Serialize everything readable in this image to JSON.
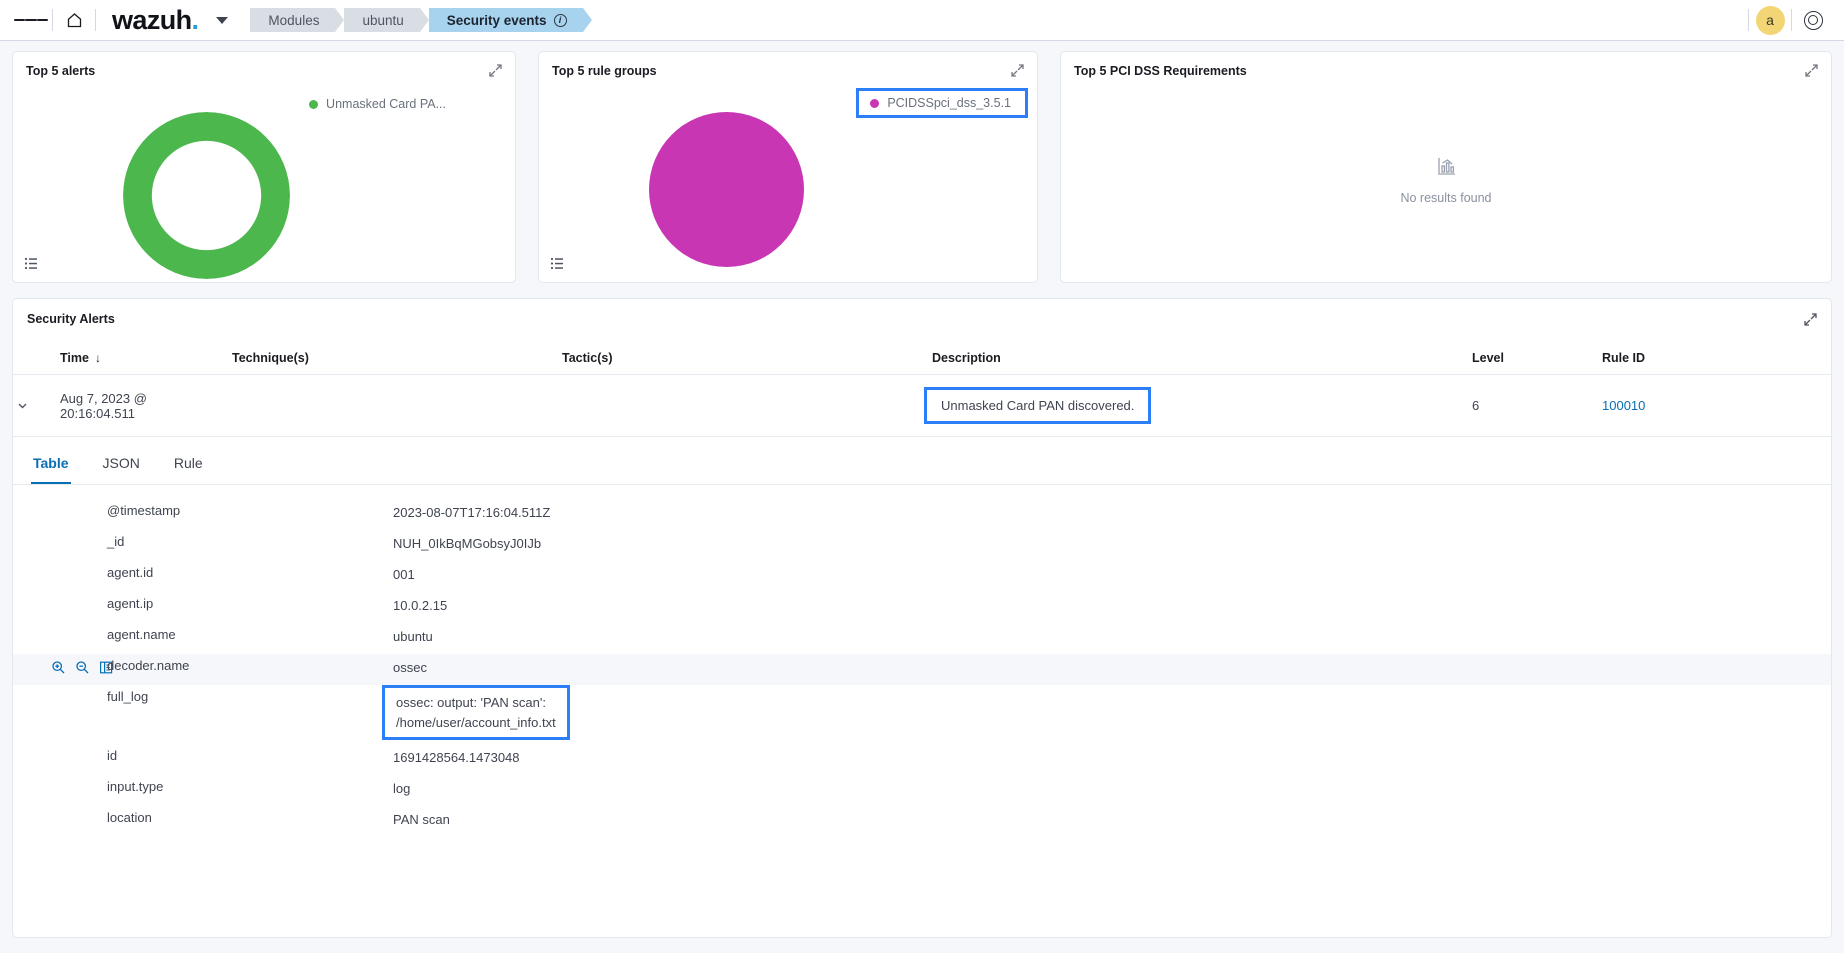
{
  "topnav": {
    "menu_icon": "hamburger-menu-icon",
    "home_icon": "home-icon",
    "logo": "wazuh",
    "logo_dot": ".",
    "breadcrumbs": [
      {
        "label": "Modules",
        "active": false
      },
      {
        "label": "ubuntu",
        "active": false
      },
      {
        "label": "Security events",
        "active": true,
        "info": "i"
      }
    ],
    "avatar_initial": "a",
    "help_icon": "lifebuoy-icon"
  },
  "panels": [
    {
      "title": "Top 5 alerts",
      "legend_label": "Unmasked Card PA...",
      "legend_color": "#4cb74c",
      "highlighted": false,
      "viz": "donut",
      "expand_icon": "expand-icon",
      "list_icon": "legend-list-icon"
    },
    {
      "title": "Top 5 rule groups",
      "legend_label": "PCIDSSpci_dss_3.5.1",
      "legend_color": "#c836b4",
      "highlighted": true,
      "viz": "pie",
      "expand_icon": "expand-icon",
      "list_icon": "legend-list-icon"
    },
    {
      "title": "Top 5 PCI DSS Requirements",
      "empty_label": "No results found",
      "empty_icon": "chart-placeholder-icon",
      "viz": "empty",
      "expand_icon": "expand-icon"
    }
  ],
  "chart_data": [
    {
      "type": "pie",
      "title": "Top 5 alerts",
      "labels": [
        "Unmasked Card PA..."
      ],
      "values": [
        100
      ],
      "colors": [
        "#4cb74c"
      ],
      "donut": true,
      "legend_position": "right"
    },
    {
      "type": "pie",
      "title": "Top 5 rule groups",
      "labels": [
        "PCIDSSpci_dss_3.5.1"
      ],
      "values": [
        100
      ],
      "colors": [
        "#c836b4"
      ],
      "donut": false,
      "legend_position": "right"
    },
    {
      "type": "pie",
      "title": "Top 5 PCI DSS Requirements",
      "labels": [],
      "values": [],
      "colors": [],
      "empty": true,
      "empty_label": "No results found"
    }
  ],
  "alerts": {
    "title": "Security Alerts",
    "columns": [
      "Time",
      "Technique(s)",
      "Tactic(s)",
      "Description",
      "Level",
      "Rule ID"
    ],
    "sort_arrow": "↓",
    "row": {
      "time": "Aug 7, 2023 @ 20:16:04.511",
      "time_line1": "Aug 7, 2023 @",
      "time_line2": "20:16:04.511",
      "technique": "",
      "tactic": "",
      "description": "Unmasked Card PAN discovered.",
      "level": "6",
      "rule_id": "100010"
    }
  },
  "tabs": [
    {
      "label": "Table",
      "active": true
    },
    {
      "label": "JSON",
      "active": false
    },
    {
      "label": "Rule",
      "active": false
    }
  ],
  "fields": [
    {
      "name": "@timestamp",
      "value": "2023-08-07T17:16:04.511Z",
      "hovered": false,
      "highlighted": false
    },
    {
      "name": "_id",
      "value": "NUH_0IkBqMGobsyJ0IJb",
      "hovered": false,
      "highlighted": false
    },
    {
      "name": "agent.id",
      "value": "001",
      "hovered": false,
      "highlighted": false
    },
    {
      "name": "agent.ip",
      "value": "10.0.2.15",
      "hovered": false,
      "highlighted": false
    },
    {
      "name": "agent.name",
      "value": "ubuntu",
      "hovered": false,
      "highlighted": false
    },
    {
      "name": "decoder.name",
      "value": "ossec",
      "hovered": true,
      "highlighted": false
    },
    {
      "name": "full_log",
      "value": "ossec: output: 'PAN scan': /home/user/account_info.txt",
      "value_line1": "ossec: output: 'PAN scan':",
      "value_line2": "/home/user/account_info.txt",
      "hovered": false,
      "highlighted": true
    },
    {
      "name": "id",
      "value": "1691428564.1473048",
      "hovered": false,
      "highlighted": false
    },
    {
      "name": "input.type",
      "value": "log",
      "hovered": false,
      "highlighted": false
    },
    {
      "name": "location",
      "value": "PAN scan",
      "hovered": false,
      "highlighted": false
    }
  ],
  "field_actions": [
    "filter-for-value-icon",
    "filter-out-value-icon",
    "toggle-column-in-table-icon"
  ],
  "colors": {
    "accent_blue": "#0a6eb4",
    "highlight_box": "#2d7ff9",
    "green": "#4cb74c",
    "magenta": "#c836b4",
    "avatar": "#f2d675"
  }
}
